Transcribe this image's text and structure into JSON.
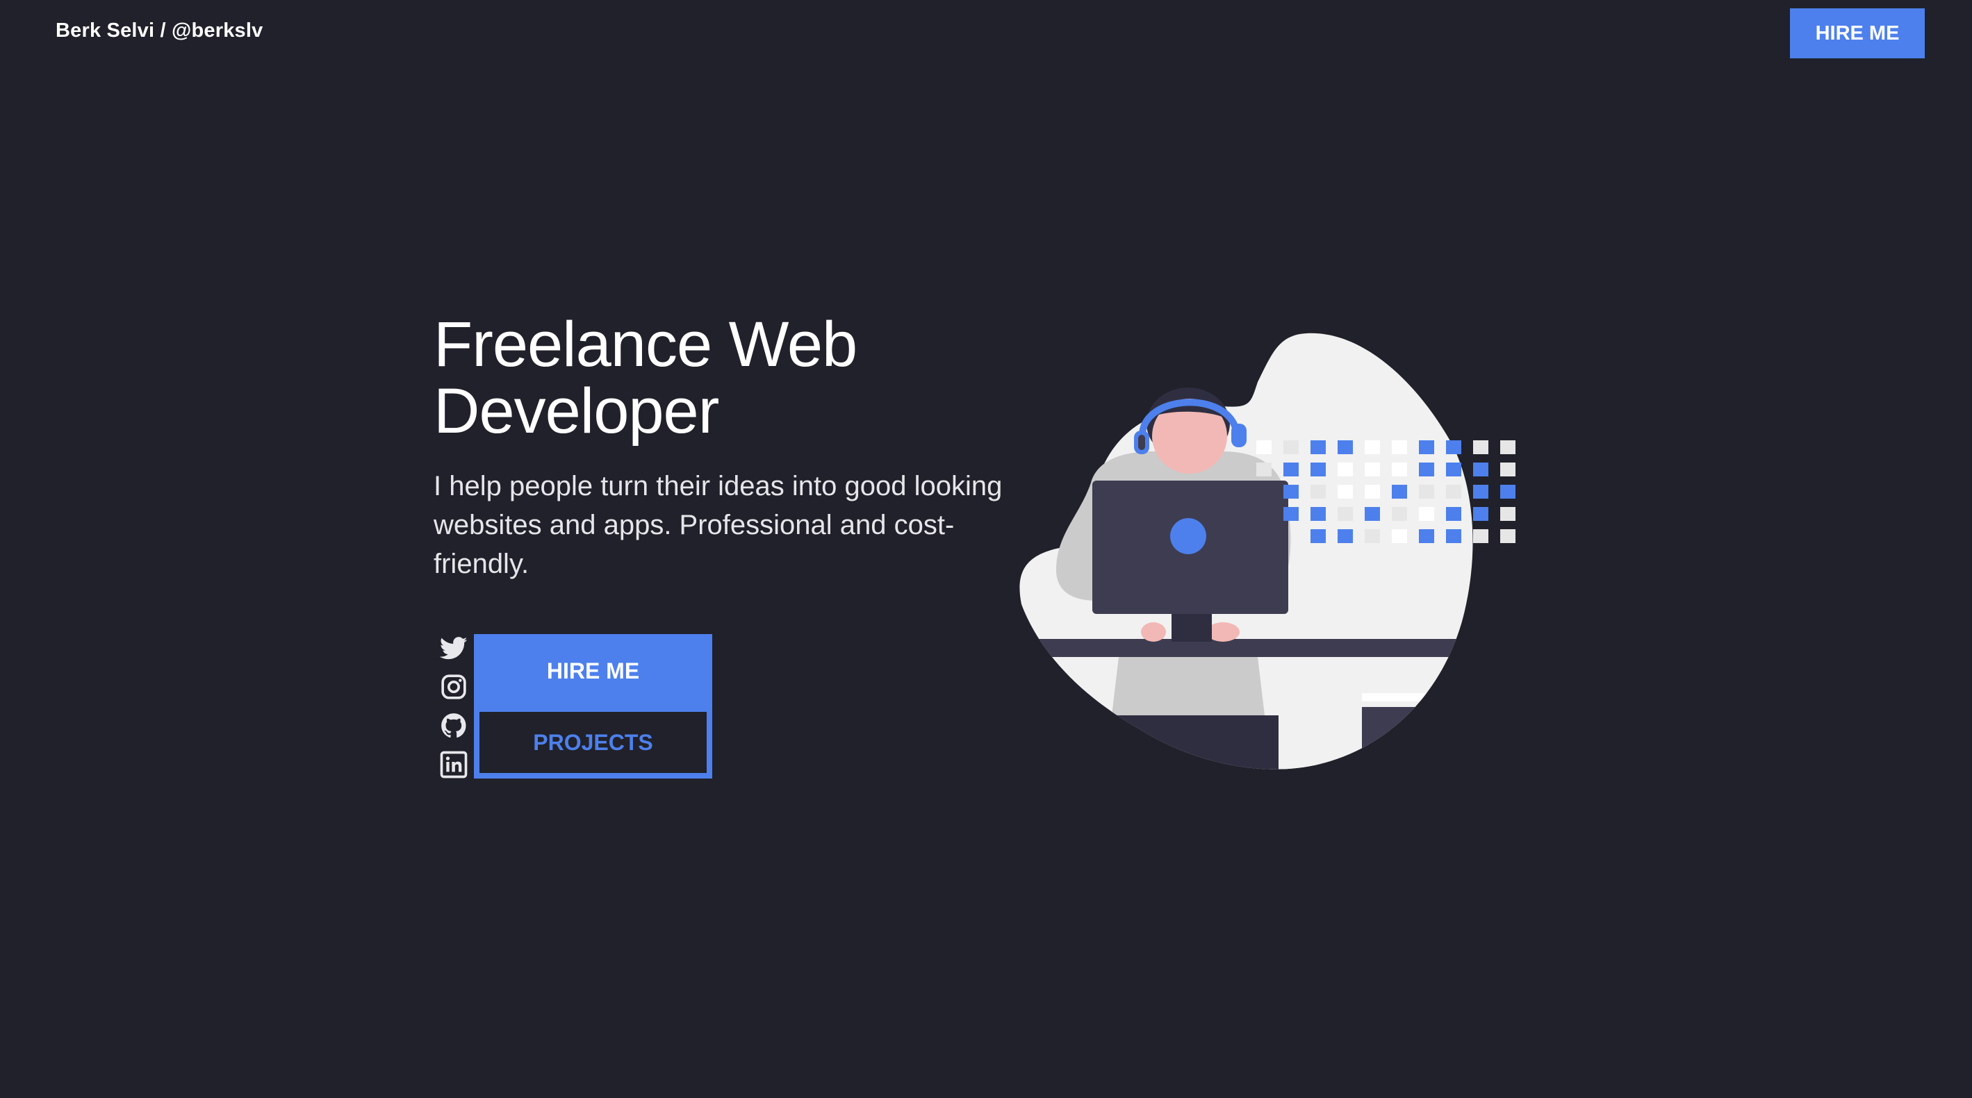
{
  "header": {
    "brand": "Berk Selvi / @berkslv",
    "hire_label": "HIRE ME"
  },
  "hero": {
    "title_line1": "Freelance Web",
    "title_line2": "Developer",
    "description": "I help people turn their ideas into good looking websites and apps. Professional and cost-friendly.",
    "hire_label": "HIRE ME",
    "projects_label": "PROJECTS"
  },
  "socials": [
    {
      "icon": "twitter-icon"
    },
    {
      "icon": "instagram-icon"
    },
    {
      "icon": "github-icon"
    },
    {
      "icon": "linkedin-icon"
    }
  ],
  "colors": {
    "background": "#20212a",
    "accent": "#4d80ec",
    "text": "#ffffff"
  }
}
